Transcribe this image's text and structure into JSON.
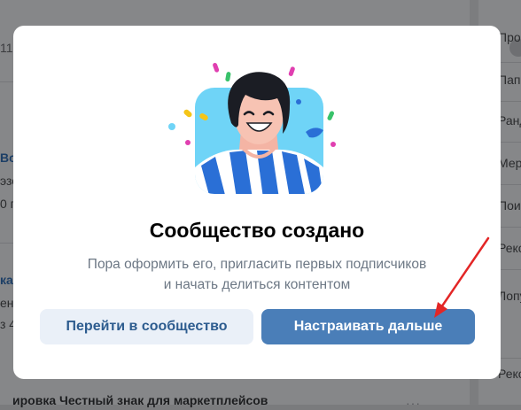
{
  "background": {
    "right_items": [
      "Про",
      "Папк",
      "Ранд",
      "Мер",
      "Поис",
      "Реко",
      "Лопу",
      "Реко"
    ],
    "left_texts": [
      "11",
      "Вс",
      "эзо",
      "0 п",
      "ка",
      "ен",
      "з 4"
    ],
    "bottom_text": "ировка Честный знак для маркетплейсов",
    "dots": "···"
  },
  "modal": {
    "title": "Сообщество создано",
    "subtitle_line1": "Пора оформить его, пригласить первых подписчиков",
    "subtitle_line2": "и начать делиться контентом",
    "secondary_button": "Перейти в сообщество",
    "primary_button": "Настраивать дальше"
  },
  "colors": {
    "primary": "#4a7eb8",
    "secondary_bg": "#eaf0f8",
    "secondary_text": "#2d5c8f",
    "annotation": "#e32626"
  }
}
